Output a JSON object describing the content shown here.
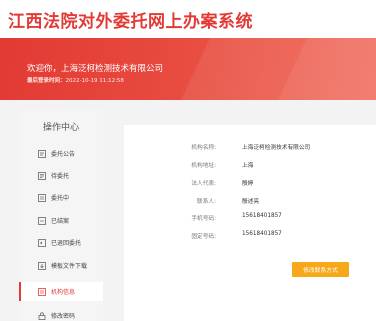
{
  "header": {
    "title": "江西法院对外委托网上办案系统"
  },
  "banner": {
    "welcome": "欢迎你，上海泛柯检测技术有限公司",
    "last_login_label": "最后登录时间：",
    "last_login_time": "2022-10-19 11:12:58"
  },
  "sidebar": {
    "title": "操作中心",
    "items": [
      {
        "label": "委托公告",
        "icon": "announcement-icon"
      },
      {
        "label": "待委托",
        "icon": "pending-doc-icon"
      },
      {
        "label": "委托中",
        "icon": "in-progress-doc-icon"
      },
      {
        "label": "已结案",
        "icon": "closed-doc-icon"
      },
      {
        "label": "已退回委托",
        "icon": "returned-doc-icon"
      },
      {
        "label": "模板文件下载",
        "icon": "template-download-icon"
      },
      {
        "label": "机构信息",
        "icon": "institution-icon"
      },
      {
        "label": "修改密码",
        "icon": "lock-icon"
      }
    ],
    "active_index": 6
  },
  "org": {
    "name_label": "机构名称:",
    "name": "上海泛柯检测技术有限公司",
    "address_label": "机构地址:",
    "address": "上海",
    "legal_label": "法人代表:",
    "legal": "殷婷",
    "contact_label": "联系人:",
    "contact": "殷述亮",
    "phone_label": "手机号码:",
    "phone": "15618401857",
    "landline_label": "固定号码:",
    "landline": "15618401857",
    "modify_button": "修改联系方式"
  },
  "colors": {
    "accent": "#e33a36",
    "button": "#f7a81a"
  }
}
